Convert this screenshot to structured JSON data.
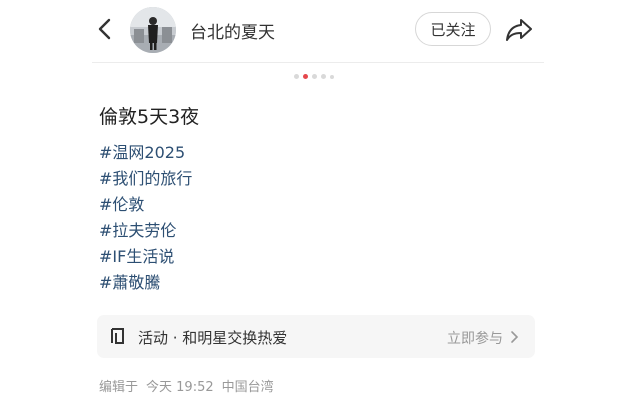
{
  "header": {
    "back_icon": "chevron-left-icon",
    "username": "台北的夏天",
    "follow_label": "已关注",
    "share_icon": "share-arrow-icon"
  },
  "carousel": {
    "total": 5,
    "active_index": 1
  },
  "post": {
    "title": "倫敦5天3夜",
    "tags": [
      "#温网2025",
      "#我们的旅行",
      "#伦敦",
      "#拉夫劳伦",
      "#IF生活说",
      "#蕭敬騰"
    ]
  },
  "activity": {
    "icon": "activity-icon",
    "label": "活动 · 和明星交换热爱",
    "link": "立即参与"
  },
  "meta": {
    "edited": "编辑于",
    "time": "今天 19:52",
    "location": "中国台湾"
  },
  "colors": {
    "accent": "#e5484d",
    "tag": "#2d4f73"
  }
}
